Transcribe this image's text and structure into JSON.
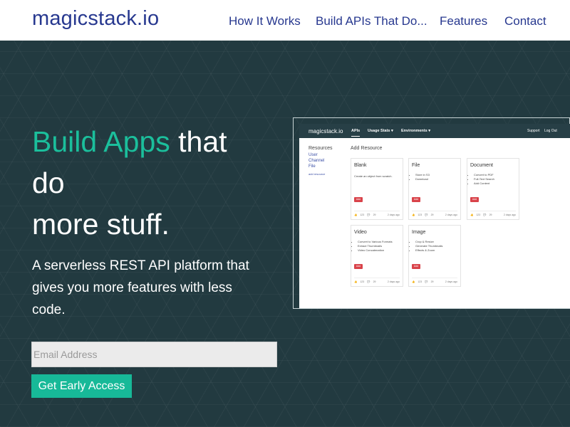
{
  "header": {
    "logo": "magicstack.io",
    "nav": [
      "How It Works",
      "Build APIs That Do...",
      "Features",
      "Contact"
    ]
  },
  "hero": {
    "headline_accent": "Build Apps",
    "headline_rest_1": " that",
    "headline_rest_2": "do",
    "headline_rest_3": "more stuff.",
    "subhead": "A serverless REST API platform that gives you more features with less code.",
    "email_placeholder": "Email Address",
    "cta_label": "Get Early Access"
  },
  "mock": {
    "logo": "magicstack.io",
    "tabs": [
      "APIs",
      "Usage Stats ▾",
      "Environments ▾"
    ],
    "right_links": [
      "Support",
      "Log Out"
    ],
    "resources_title": "Resources",
    "resources": [
      "User",
      "Channel",
      "File"
    ],
    "add_resource_link": "add resource",
    "add_resource_title": "Add Resource",
    "cards": [
      {
        "title": "Blank",
        "desc": "Create an object from scratch.",
        "items": [],
        "add": "Add",
        "likes": "123",
        "comments": "29",
        "age": "2 days ago"
      },
      {
        "title": "File",
        "desc": "",
        "items": [
          "Store in S3",
          "Download"
        ],
        "add": "Add",
        "likes": "123",
        "comments": "29",
        "age": "2 days ago"
      },
      {
        "title": "Document",
        "desc": "",
        "items": [
          "Convert to PDF",
          "Full-Text Search",
          "Add Content"
        ],
        "add": "Add",
        "likes": "123",
        "comments": "29",
        "age": "2 days ago"
      },
      {
        "title": "Video",
        "desc": "",
        "items": [
          "Convert to Various Formats",
          "Extract Thumbnails",
          "Video Concatenation"
        ],
        "add": "Add",
        "likes": "123",
        "comments": "29",
        "age": "2 days ago"
      },
      {
        "title": "Image",
        "desc": "",
        "items": [
          "Crop & Resize",
          "Generate Thumbnails",
          "Effects & Zoom"
        ],
        "add": "Add",
        "likes": "123",
        "comments": "29",
        "age": "2 days ago"
      }
    ]
  },
  "colors": {
    "brand": "#27388f",
    "accent": "#1bbf9c",
    "hero_bg": "#223a40",
    "cta_bg": "#17b998",
    "mock_add": "#d9434a"
  }
}
